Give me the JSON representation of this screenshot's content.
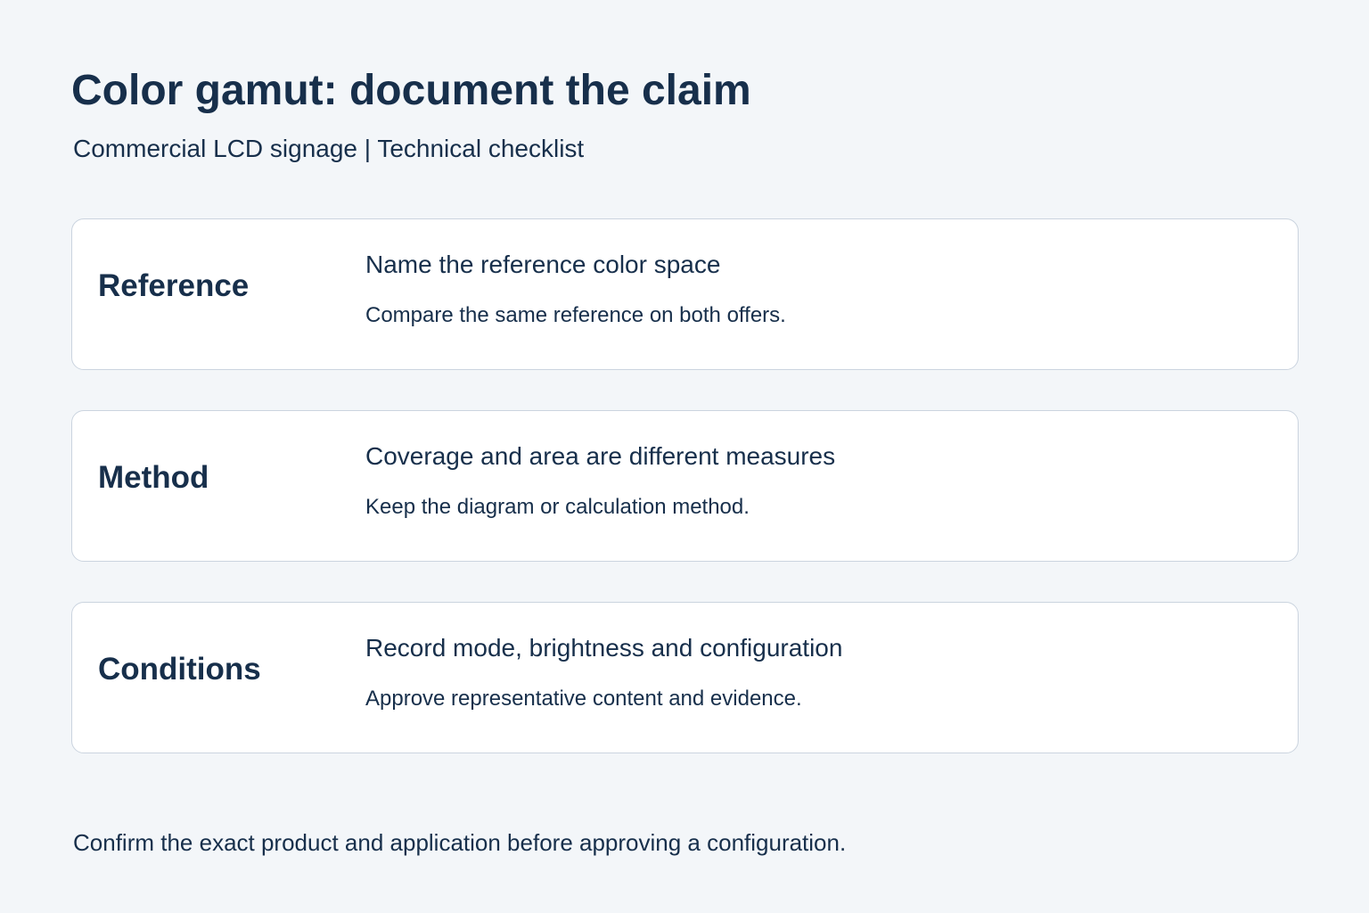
{
  "page": {
    "title": "Color gamut: document the claim",
    "subtitle": "Commercial LCD signage | Technical checklist"
  },
  "checklist": {
    "items": [
      {
        "label": "Reference",
        "heading": "Name the reference color space",
        "detail": "Compare the same reference on both offers."
      },
      {
        "label": "Method",
        "heading": "Coverage and area are different measures",
        "detail": "Keep the diagram or calculation method."
      },
      {
        "label": "Conditions",
        "heading": "Record mode, brightness and configuration",
        "detail": "Approve representative content and evidence."
      }
    ]
  },
  "footer": {
    "note": "Confirm the exact product and application before approving a configuration."
  },
  "colors": {
    "background": "#f3f6f9",
    "text": "#172f4b",
    "card_background": "#ffffff",
    "card_border": "#cbd4df"
  }
}
